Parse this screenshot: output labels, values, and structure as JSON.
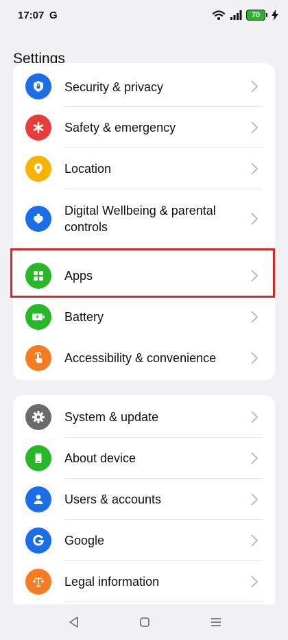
{
  "status_bar": {
    "time": "17:07",
    "g_label": "G",
    "battery": "70"
  },
  "header": {
    "title": "Settings"
  },
  "group1": [
    {
      "label": "Security & privacy",
      "icon": "shield-lock-icon",
      "color": "#1a6ee8"
    },
    {
      "label": "Safety & emergency",
      "icon": "asterisk-icon",
      "color": "#e83b3b"
    },
    {
      "label": "Location",
      "icon": "location-pin-icon",
      "color": "#f5b400"
    },
    {
      "label": "Digital Wellbeing & parental controls",
      "icon": "wellbeing-heart-icon",
      "color": "#1a6ee8"
    },
    {
      "label": "Apps",
      "icon": "apps-grid-icon",
      "color": "#27b827"
    },
    {
      "label": "Battery",
      "icon": "battery-charging-icon",
      "color": "#27b827"
    },
    {
      "label": "Accessibility & convenience",
      "icon": "hand-touch-icon",
      "color": "#f57c1f"
    }
  ],
  "group2": [
    {
      "label": "System & update",
      "icon": "gear-icon",
      "color": "#6b6b6b"
    },
    {
      "label": "About device",
      "icon": "phone-device-icon",
      "color": "#27b827"
    },
    {
      "label": "Users & accounts",
      "icon": "user-icon",
      "color": "#1a6ee8"
    },
    {
      "label": "Google",
      "icon": "google-g-icon",
      "color": "#1a6ee8"
    },
    {
      "label": "Legal information",
      "icon": "scales-icon",
      "color": "#f57c1f"
    }
  ],
  "nav": {
    "back": "back-icon",
    "home": "home-icon",
    "recents": "recents-icon"
  }
}
